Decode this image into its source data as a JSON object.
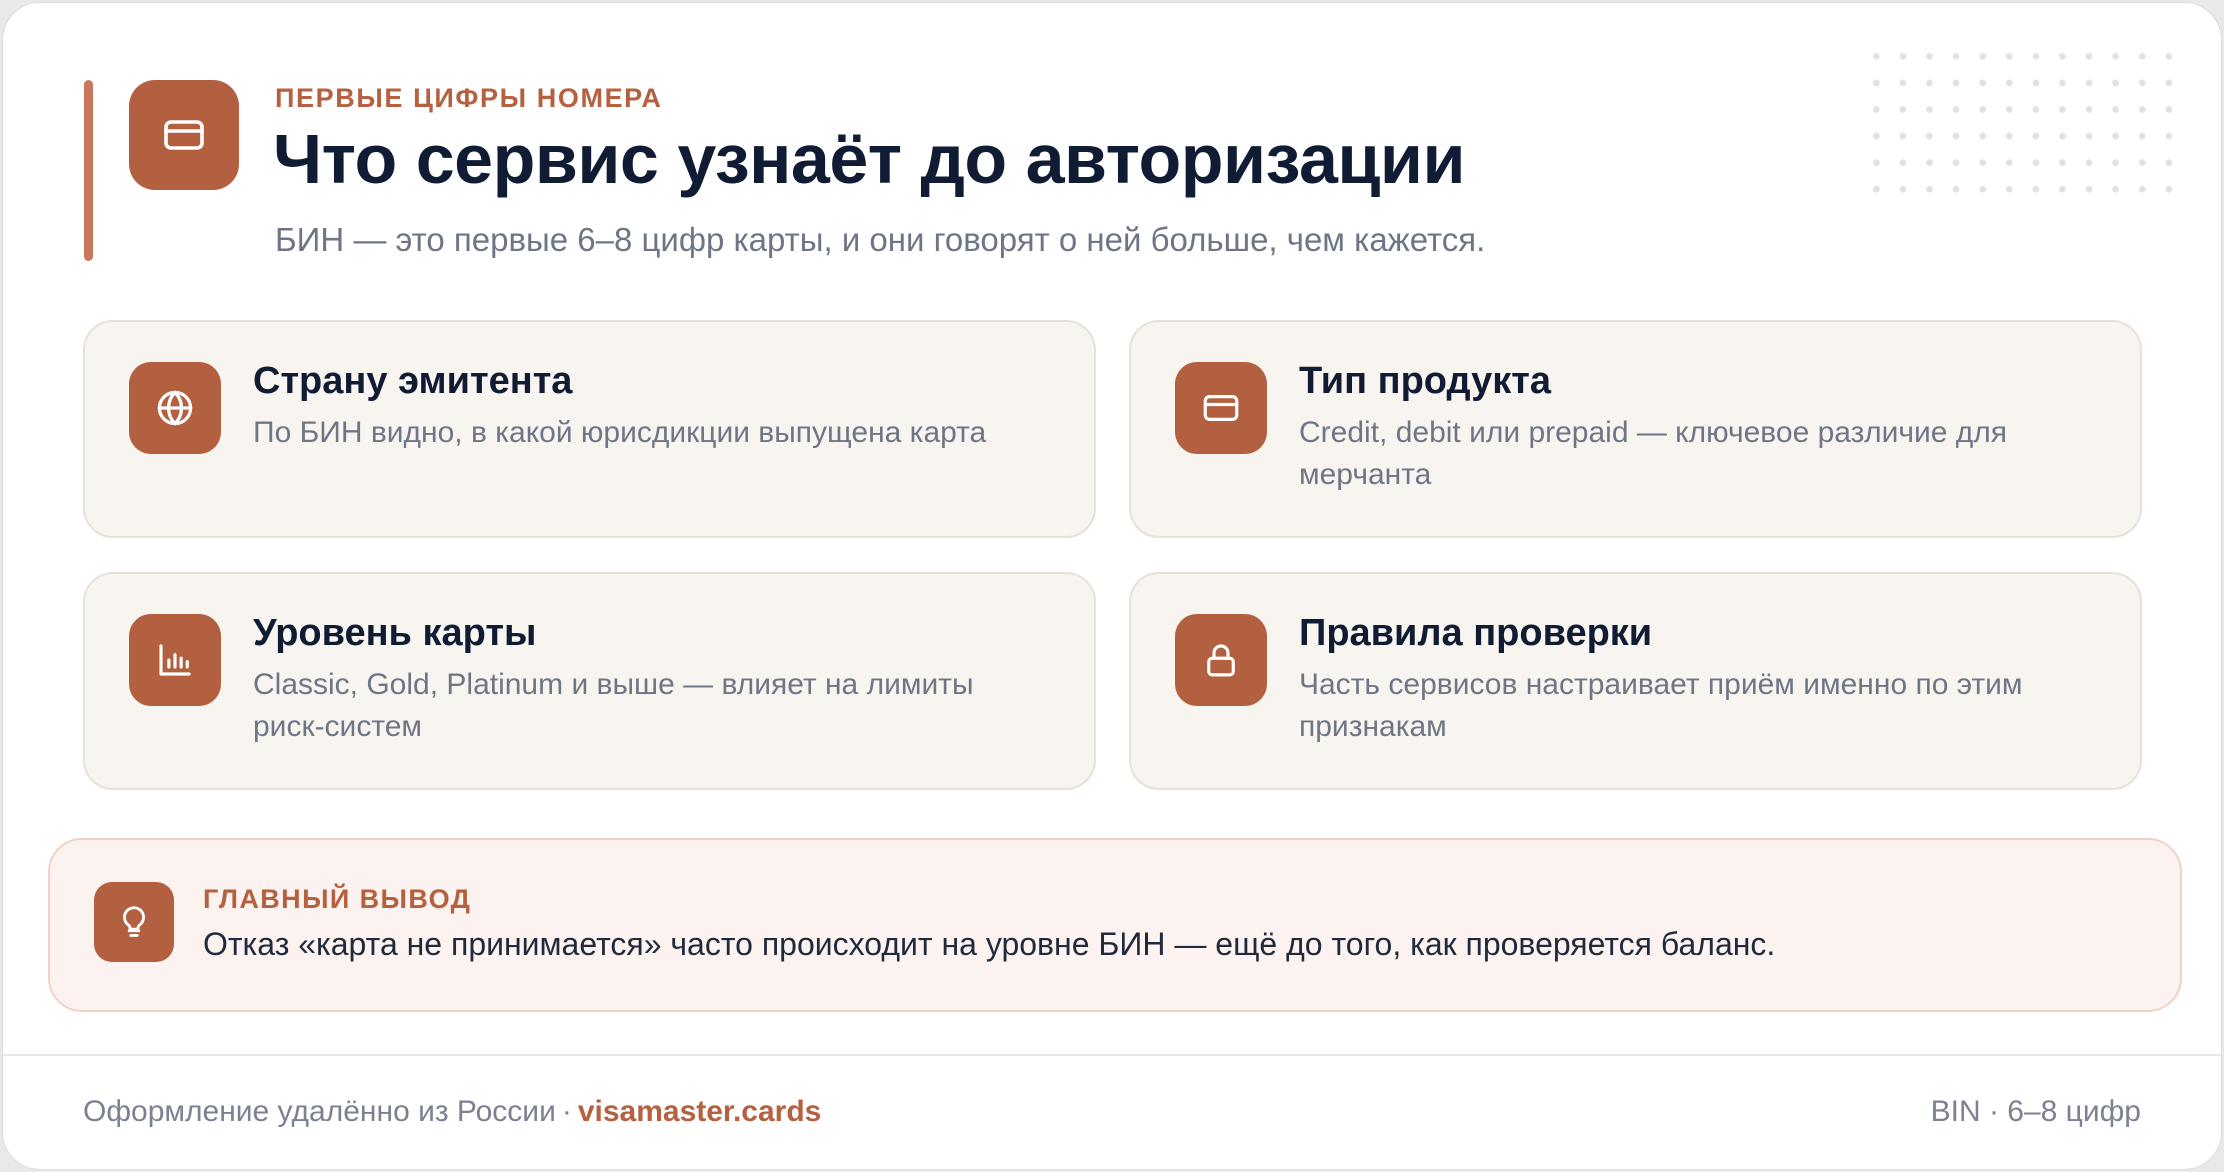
{
  "header": {
    "icon": "credit-card-icon",
    "eyebrow": "Первые цифры номера",
    "title": "Что сервис узнаёт до авторизации",
    "subtitle": "БИН — это первые 6–8 цифр карты, и они говорят о ней больше, чем кажется."
  },
  "features": [
    {
      "icon": "globe-icon",
      "title": "Страну эмитента",
      "description": "По БИН видно, в какой юрисдикции выпущена карта"
    },
    {
      "icon": "credit-card-icon",
      "title": "Тип продукта",
      "description": "Credit, debit или prepaid — ключевое различие для мерчанта"
    },
    {
      "icon": "bar-chart-icon",
      "title": "Уровень карты",
      "description": "Classic, Gold, Platinum и выше — влияет на лимиты риск-систем"
    },
    {
      "icon": "lock-icon",
      "title": "Правила проверки",
      "description": "Часть сервисов настраивает приём именно по этим признакам"
    }
  ],
  "takeaway": {
    "icon": "lightbulb-icon",
    "label": "Главный вывод",
    "text": "Отказ «карта не принимается» часто происходит на уровне БИН — ещё до того, как проверяется баланс."
  },
  "footer": {
    "left_text": "Оформление удалённо из России",
    "separator": "·",
    "link_text": "visamaster.cards",
    "right_text": "BIN · 6–8 цифр"
  },
  "colors": {
    "accent": "#b2603f",
    "title": "#101c33",
    "muted": "#6e7686",
    "feature_bg": "#f8f5f0",
    "takeaway_bg": "#fcf2ef"
  }
}
